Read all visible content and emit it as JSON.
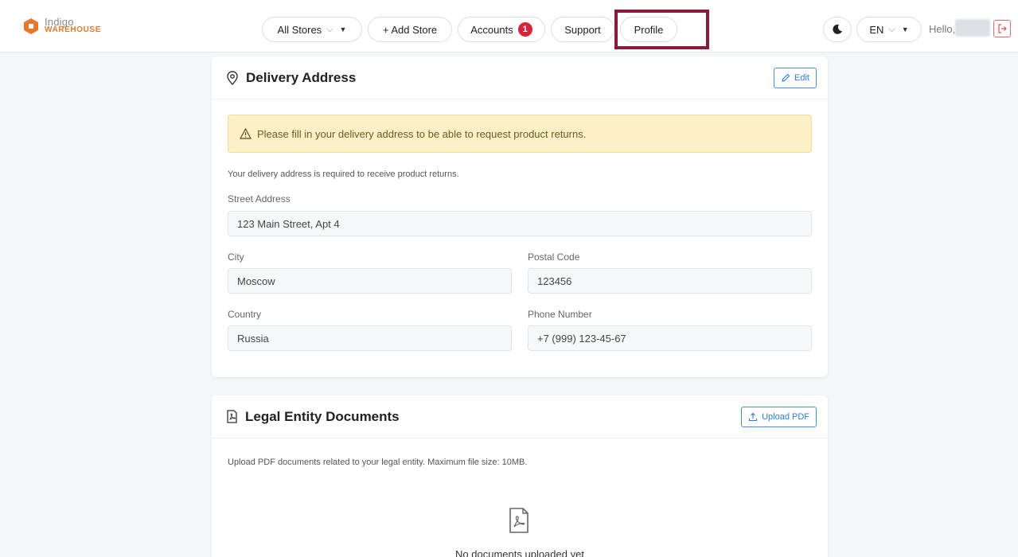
{
  "header": {
    "logo": {
      "top": "Indigo",
      "bottom": "WAREHOUSE"
    },
    "nav": {
      "stores_label": "All Stores",
      "add_store_label": "+ Add Store",
      "accounts_label": "Accounts",
      "accounts_badge": "1",
      "support_label": "Support",
      "profile_label": "Profile"
    },
    "language": "EN",
    "greeting": "Hello,",
    "colors": {
      "accent": "#e8772e",
      "highlight_box": "#8b1a3a",
      "badge": "#d9253a"
    }
  },
  "delivery": {
    "title": "Delivery Address",
    "edit_label": "Edit",
    "warning": "Please fill in your delivery address to be able to request product returns.",
    "hint": "Your delivery address is required to receive product returns.",
    "street_label": "Street Address",
    "street_value": "123 Main Street, Apt 4",
    "city_label": "City",
    "city_value": "Moscow",
    "postal_label": "Postal Code",
    "postal_value": "123456",
    "country_label": "Country",
    "country_value": "Russia",
    "phone_label": "Phone Number",
    "phone_value": "+7 (999) 123-45-67"
  },
  "legal": {
    "title": "Legal Entity Documents",
    "upload_label": "Upload PDF",
    "description": "Upload PDF documents related to your legal entity. Maximum file size: 10MB.",
    "empty_text": "No documents uploaded yet"
  }
}
